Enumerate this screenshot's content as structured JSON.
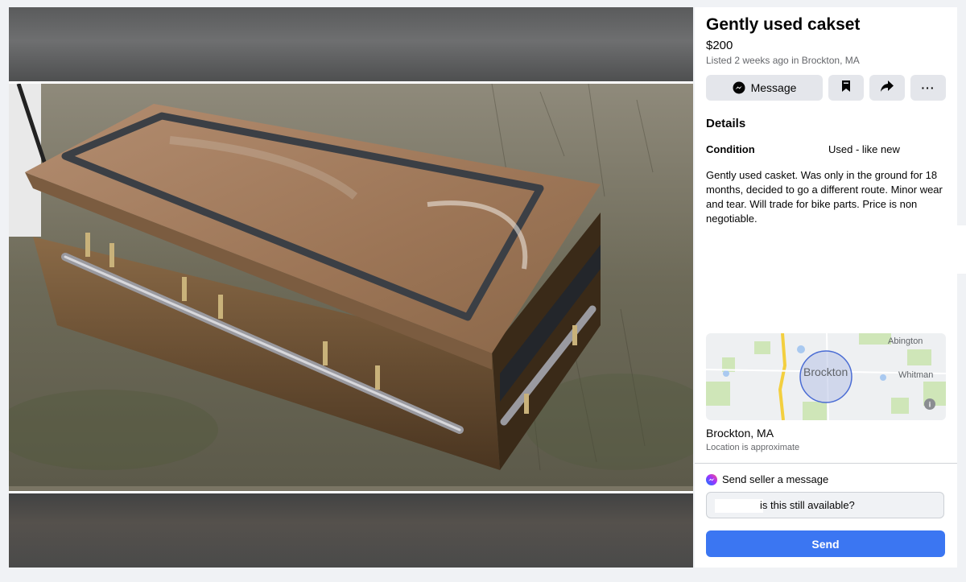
{
  "listing": {
    "title": "Gently used cakset",
    "price": "$200",
    "meta": "Listed 2 weeks ago in Brockton, MA"
  },
  "actions": {
    "message_label": "Message",
    "save_icon": "bookmark-icon",
    "share_icon": "share-icon",
    "more_label": "···"
  },
  "details": {
    "heading": "Details",
    "condition_label": "Condition",
    "condition_value": "Used - like new",
    "description": "Gently used casket.  Was only in the ground for 18 months, decided to go a different route.  Minor wear and tear.  Will trade for bike parts.  Price is non negotiable."
  },
  "map": {
    "labels": [
      "Abington",
      "Brockton",
      "Whitman"
    ]
  },
  "location": {
    "name": "Brockton, MA",
    "note": "Location is approximate"
  },
  "seller_message": {
    "heading": "Send seller a message",
    "input_value": "is this still available?",
    "send_label": "Send"
  },
  "colors": {
    "send_button": "#3b76f2",
    "button_bg": "#e4e6eb",
    "messenger_gradient": [
      "#0a7cff",
      "#a033ff",
      "#ff5280"
    ]
  }
}
